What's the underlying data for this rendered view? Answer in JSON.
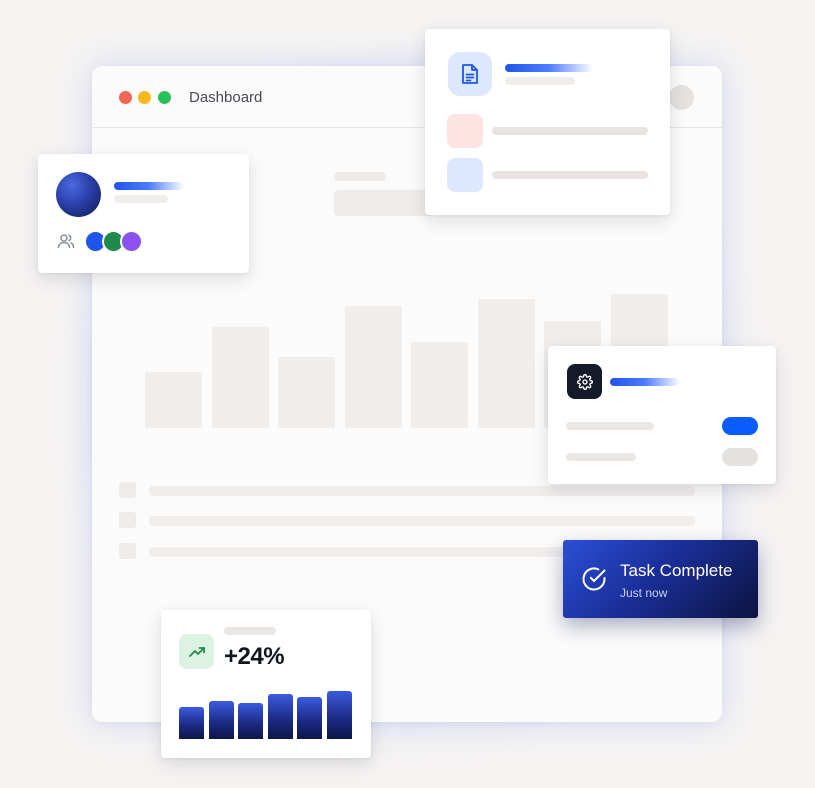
{
  "window": {
    "title": "Dashboard",
    "traffic_lights": {
      "close": "#f26657",
      "minimize": "#f5b91d",
      "maximize": "#29c25a"
    }
  },
  "background_chart": {
    "levels": [
      0.42,
      0.75,
      0.53,
      0.91,
      0.64,
      0.96,
      0.8,
      1.0
    ]
  },
  "document_card": {
    "icon": "document-icon",
    "accent": "#dde8ff",
    "item_colors": [
      "#fde4e2",
      "#dde8ff"
    ]
  },
  "settings_card": {
    "icon": "gear-icon",
    "toggle_on_color": "#0b5cff",
    "toggle_off_color": "#e4e1df"
  },
  "toast": {
    "title": "Task Complete",
    "subtitle": "Just now",
    "icon": "check-circle-icon"
  },
  "stats_card": {
    "icon": "trending-up-icon",
    "value": "+24%",
    "levels": [
      0.67,
      0.8,
      0.76,
      0.93,
      0.87,
      1.0
    ]
  },
  "profile_card": {
    "icon": "users-icon",
    "avatar_colors": [
      "#1f55e8",
      "#1f8a4c",
      "#8b52f0"
    ]
  }
}
